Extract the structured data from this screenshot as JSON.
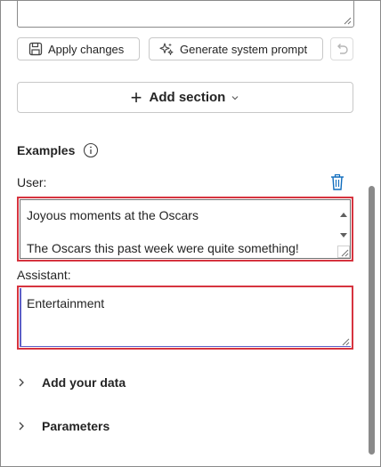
{
  "toolbar": {
    "apply_label": "Apply changes",
    "generate_label": "Generate system prompt"
  },
  "add_section": {
    "label": "Add section"
  },
  "examples": {
    "heading": "Examples",
    "user_label": "User:",
    "user_lines": [
      "Joyous moments at the Oscars",
      "The Oscars this past week were quite something!"
    ],
    "assistant_label": "Assistant:",
    "assistant_value": "Entertainment"
  },
  "sections": {
    "add_data": "Add your data",
    "parameters": "Parameters"
  },
  "icons": {
    "save": "save-icon",
    "sparkle": "sparkle-icon",
    "undo": "undo-icon",
    "info": "info-icon",
    "trash": "trash-icon",
    "chevron": "chevron-right-icon"
  },
  "colors": {
    "highlight_border": "#d6343f",
    "focus_border": "#5b5fc7",
    "trash_blue": "#0f6cbd"
  }
}
